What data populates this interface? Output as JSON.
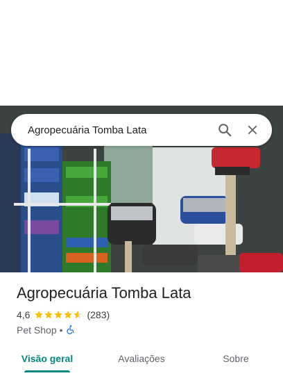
{
  "search": {
    "query": "Agropecuária Tomba Lata"
  },
  "place": {
    "name": "Agropecuária Tomba Lata",
    "rating": "4,6",
    "stars": 4.6,
    "review_count": "(283)",
    "category": "Pet Shop",
    "separator": "•"
  },
  "icons": {
    "search": "search-icon",
    "close": "close-icon",
    "accessible": "wheelchair-accessible-icon",
    "star": "star-icon"
  },
  "tabs": [
    {
      "label": "Visão geral",
      "active": true
    },
    {
      "label": "Avaliações",
      "active": false
    },
    {
      "label": "Sobre",
      "active": false
    }
  ],
  "colors": {
    "accent": "#01877e",
    "star": "#fbbc04",
    "accessible": "#1a73e8"
  }
}
